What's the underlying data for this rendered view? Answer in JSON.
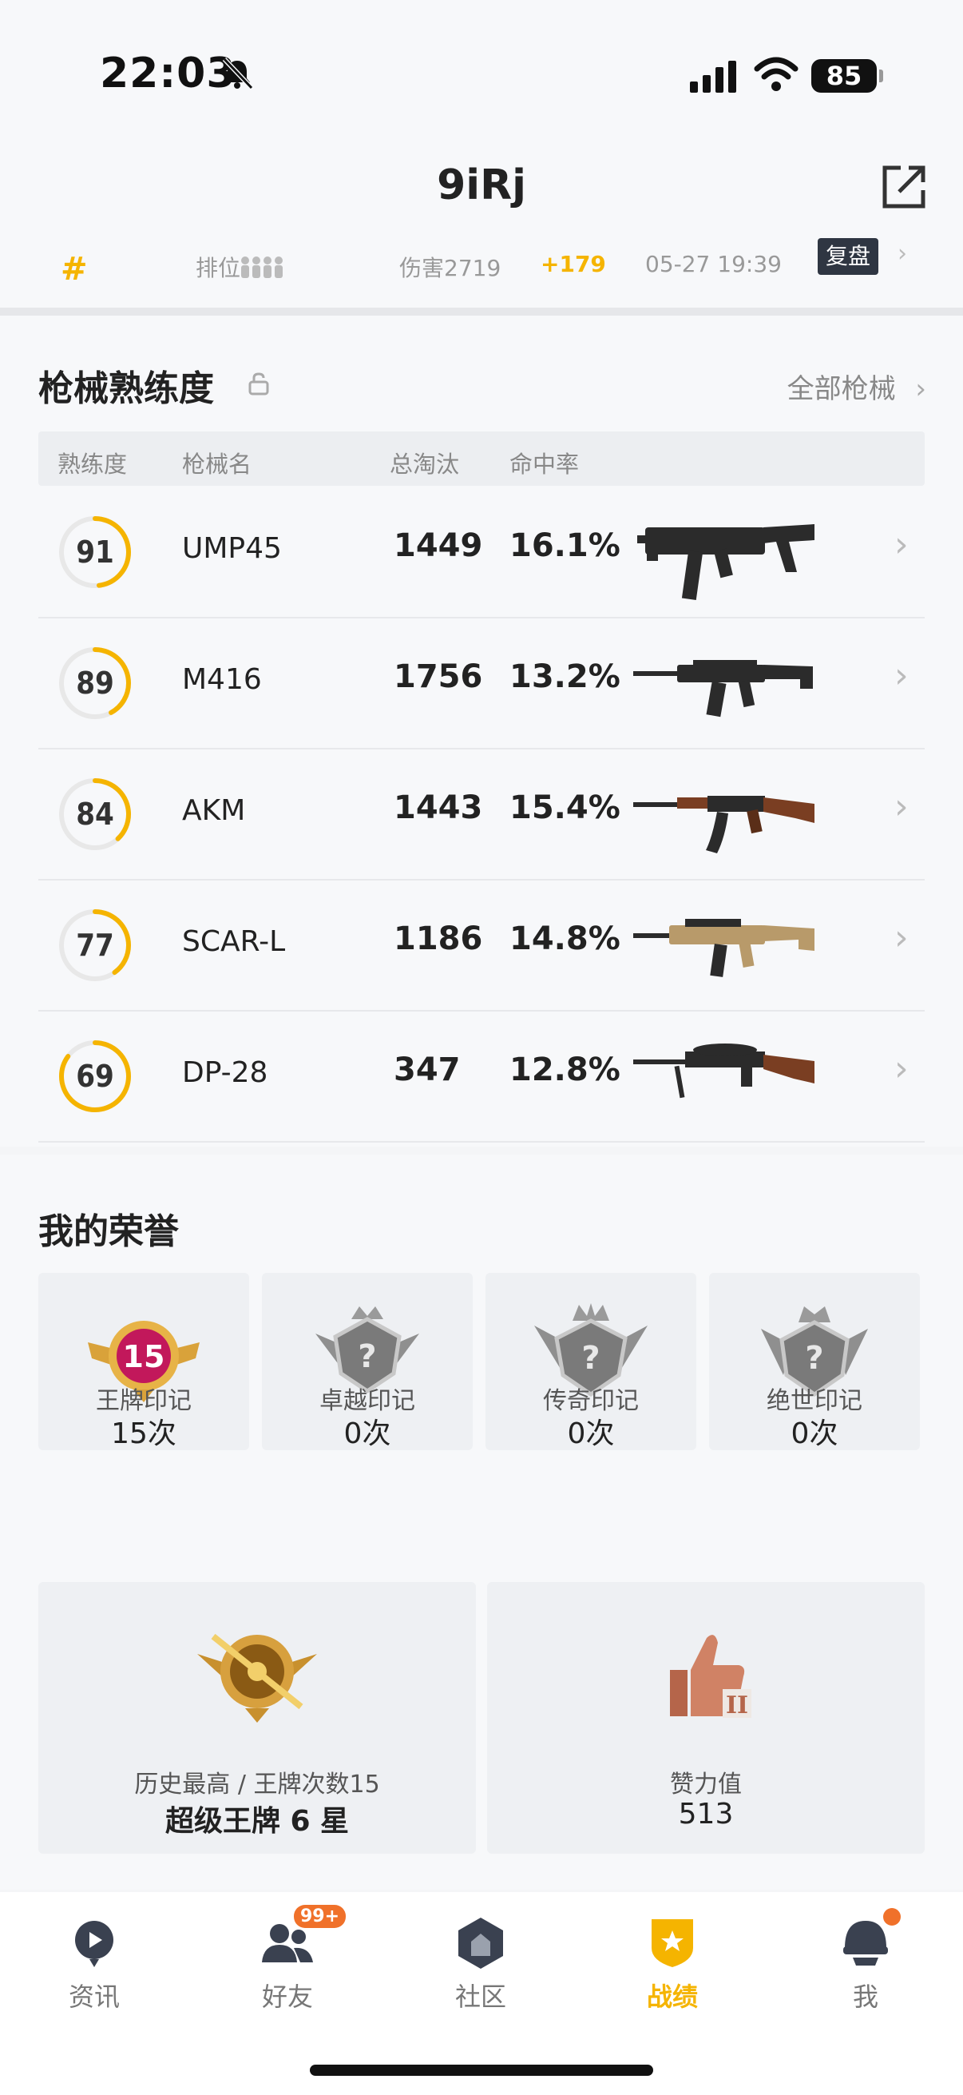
{
  "status": {
    "time": "22:03",
    "battery": "85"
  },
  "header": {
    "title": "9iRj",
    "match": {
      "rank": "#",
      "mode": "排位",
      "damage": "伤害2719",
      "delta": "+179",
      "datetime": "05-27 19:39",
      "replay": "复盘"
    }
  },
  "weapons": {
    "title": "枪械熟练度",
    "all_link": "全部枪械",
    "columns": [
      "熟练度",
      "枪械名",
      "总淘汰",
      "命中率"
    ],
    "rows": [
      {
        "level": "91",
        "name": "UMP45",
        "kills": "1449",
        "accuracy": "16.1%",
        "progress": 0.48
      },
      {
        "level": "89",
        "name": "M416",
        "kills": "1756",
        "accuracy": "13.2%",
        "progress": 0.42
      },
      {
        "level": "84",
        "name": "AKM",
        "kills": "1443",
        "accuracy": "15.4%",
        "progress": 0.38
      },
      {
        "level": "77",
        "name": "SCAR-L",
        "kills": "1186",
        "accuracy": "14.8%",
        "progress": 0.4
      },
      {
        "level": "69",
        "name": "DP-28",
        "kills": "347",
        "accuracy": "12.8%",
        "progress": 0.85
      }
    ]
  },
  "honors": {
    "title": "我的荣誉",
    "marks": [
      {
        "label": "王牌印记",
        "value": "15次",
        "emblem_number": "15"
      },
      {
        "label": "卓越印记",
        "value": "0次"
      },
      {
        "label": "传奇印记",
        "value": "0次"
      },
      {
        "label": "绝世印记",
        "value": "0次"
      }
    ],
    "history": {
      "label": "历史最高 / 王牌次数15",
      "value": "超级王牌 6 星"
    },
    "likes": {
      "label": "赞力值",
      "value": "513"
    }
  },
  "tabs": [
    {
      "label": "资讯",
      "icon": "news-icon"
    },
    {
      "label": "好友",
      "icon": "friends-icon",
      "badge": "99+"
    },
    {
      "label": "社区",
      "icon": "community-icon"
    },
    {
      "label": "战绩",
      "icon": "record-icon",
      "active": true
    },
    {
      "label": "我",
      "icon": "profile-icon"
    }
  ],
  "colors": {
    "accent": "#f5b400",
    "ring_track": "#e8e8e8",
    "badge": "#f0712a"
  }
}
